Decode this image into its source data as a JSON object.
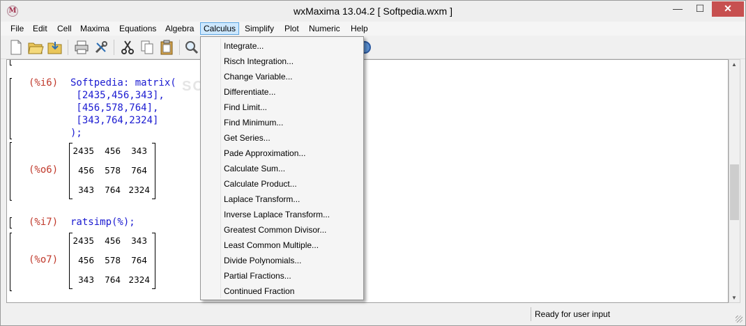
{
  "window": {
    "title": "wxMaxima 13.04.2  [ Softpedia.wxm ]",
    "controls": {
      "minimize": "—",
      "maximize": "☐",
      "close": "✕"
    }
  },
  "menubar": {
    "items": [
      "File",
      "Edit",
      "Cell",
      "Maxima",
      "Equations",
      "Algebra",
      "Calculus",
      "Simplify",
      "Plot",
      "Numeric",
      "Help"
    ],
    "active": "Calculus"
  },
  "toolbar": {
    "buttons": [
      "new-icon",
      "open-icon",
      "save-icon",
      "print-icon",
      "preferences-icon",
      "cut-icon",
      "copy-icon",
      "paste-icon",
      "find-icon"
    ]
  },
  "calculus_menu": {
    "items": [
      "Integrate...",
      "Risch Integration...",
      "Change Variable...",
      "Differentiate...",
      "Find Limit...",
      "Find Minimum...",
      "Get Series...",
      "Pade Approximation...",
      "Calculate Sum...",
      "Calculate Product...",
      "Laplace Transform...",
      "Inverse Laplace Transform...",
      "Greatest Common Divisor...",
      "Least Common Multiple...",
      "Divide Polynomials...",
      "Partial Fractions...",
      "Continued Fraction"
    ]
  },
  "worksheet": {
    "cell1": {
      "input_label": "(%i6)",
      "input_lines": [
        "Softpedia: matrix(",
        " [2435,456,343],",
        " [456,578,764],",
        " [343,764,2324]",
        ");"
      ],
      "output_label": "(%o6)",
      "matrix": [
        [
          "2435",
          "456",
          "343"
        ],
        [
          "456",
          "578",
          "764"
        ],
        [
          "343",
          "764",
          "2324"
        ]
      ]
    },
    "cell2": {
      "input_label": "(%i7)",
      "input_lines": [
        "ratsimp(%);"
      ],
      "output_label": "(%o7)",
      "matrix": [
        [
          "2435",
          "456",
          "343"
        ],
        [
          "456",
          "578",
          "764"
        ],
        [
          "343",
          "764",
          "2324"
        ]
      ]
    }
  },
  "watermark": "SOFTPEDIA",
  "statusbar": {
    "text": "Ready for user input"
  },
  "colors": {
    "label": "#c0392b",
    "input": "#1a1ad1",
    "menu_highlight": "#cde8ff"
  }
}
